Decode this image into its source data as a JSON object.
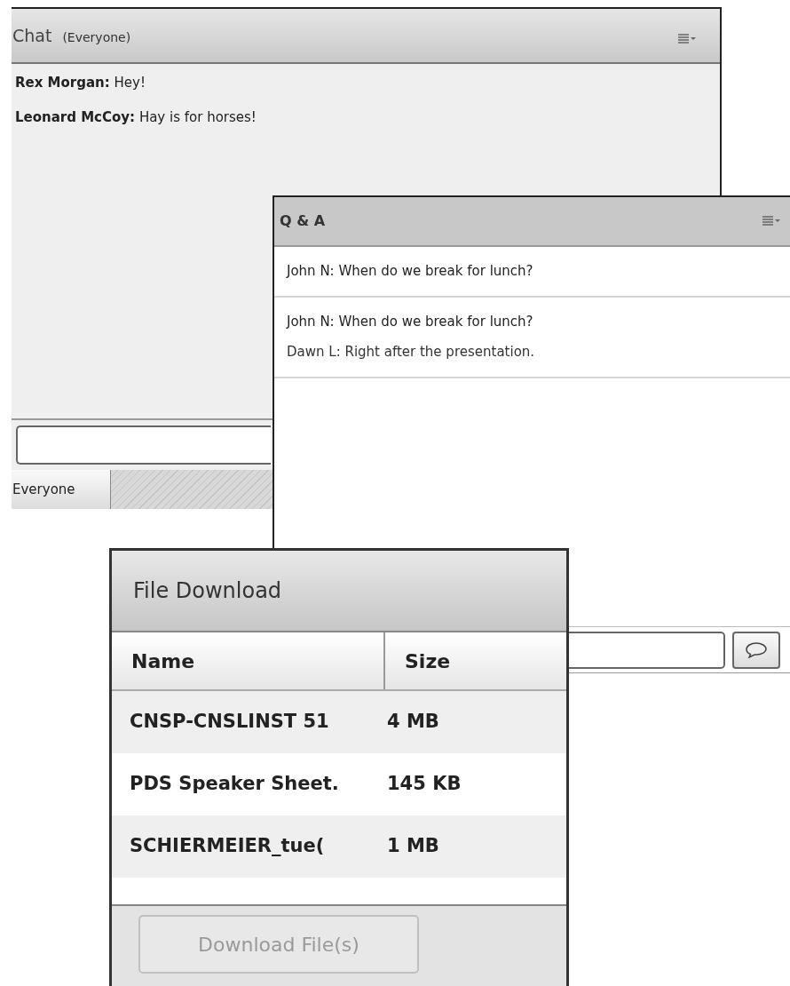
{
  "chat": {
    "title": "Chat",
    "audience": "(Everyone)",
    "messages": [
      {
        "sender": "Rex Morgan:",
        "text": "Hey!"
      },
      {
        "sender": "Leonard McCoy:",
        "text": "Hay is for horses!"
      }
    ],
    "tabs": [
      {
        "label": "Everyone",
        "selected": true
      }
    ]
  },
  "qa": {
    "title": "Q & A",
    "threads": [
      {
        "question": "John N: When do we break for lunch?"
      },
      {
        "question": "John N: When do we break for lunch?",
        "answers": [
          "Dawn L: Right after the presentation."
        ]
      }
    ]
  },
  "file_download": {
    "title": "File Download",
    "columns": [
      "Name",
      "Size"
    ],
    "rows": [
      {
        "name": "CNSP-CNSLINST 51",
        "size": "4 MB"
      },
      {
        "name": "PDS Speaker Sheet.",
        "size": "145 KB"
      },
      {
        "name": "SCHIERMEIER_tue(",
        "size": "1 MB"
      }
    ],
    "button": {
      "label": "Download File(s)",
      "disabled": true
    }
  }
}
